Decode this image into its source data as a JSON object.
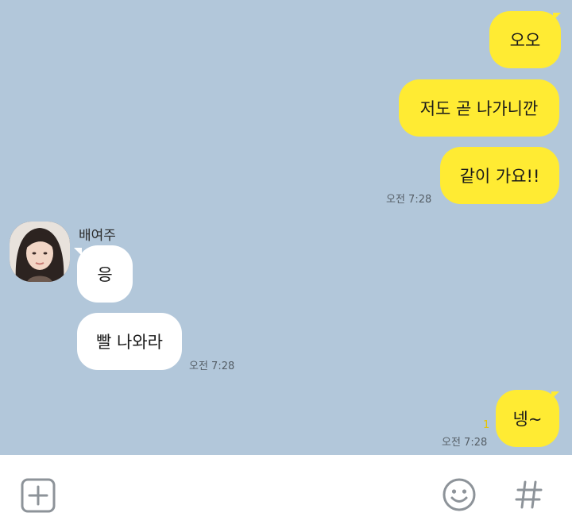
{
  "messages": {
    "m1": "오오",
    "m2": "저도 곧 나가니깐",
    "m3": "같이 가요!!",
    "m3_time": "오전 7:28",
    "sender_name": "배여주",
    "m4": "응",
    "m5": "빨 나와라",
    "m5_time": "오전 7:28",
    "m6": "넹~",
    "m6_unread": "1",
    "m6_time": "오전 7:28"
  },
  "icons": {
    "add": "plus-square-icon",
    "emoji": "smiley-icon",
    "hash": "hash-icon"
  },
  "colors": {
    "background": "#b2c7da",
    "my_bubble": "#ffeb33",
    "their_bubble": "#ffffff"
  }
}
